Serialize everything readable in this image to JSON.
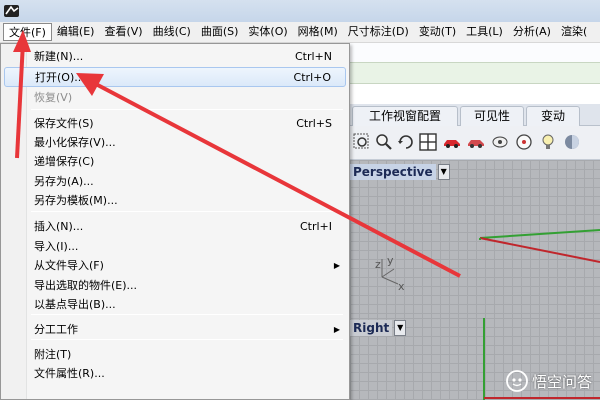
{
  "menubar": {
    "items": [
      {
        "label": "文件(F)",
        "active": true
      },
      {
        "label": "编辑(E)"
      },
      {
        "label": "查看(V)"
      },
      {
        "label": "曲线(C)"
      },
      {
        "label": "曲面(S)"
      },
      {
        "label": "实体(O)"
      },
      {
        "label": "网格(M)"
      },
      {
        "label": "尺寸标注(D)"
      },
      {
        "label": "变动(T)"
      },
      {
        "label": "工具(L)"
      },
      {
        "label": "分析(A)"
      },
      {
        "label": "渲染("
      }
    ]
  },
  "file_menu": {
    "items": [
      {
        "label": "新建(N)...",
        "shortcut": "Ctrl+N"
      },
      {
        "label": "打开(O)...",
        "shortcut": "Ctrl+O",
        "highlighted": true
      },
      {
        "label": "恢复(V)",
        "disabled": true
      },
      {
        "label": "保存文件(S)",
        "shortcut": "Ctrl+S"
      },
      {
        "label": "最小化保存(V)..."
      },
      {
        "label": "递增保存(C)"
      },
      {
        "label": "另存为(A)..."
      },
      {
        "label": "另存为模板(M)..."
      },
      {
        "label": "插入(N)...",
        "shortcut": "Ctrl+I"
      },
      {
        "label": "导入(I)..."
      },
      {
        "label": "从文件导入(F)",
        "submenu": true
      },
      {
        "label": "导出选取的物件(E)..."
      },
      {
        "label": "以基点导出(B)..."
      },
      {
        "label": "分工工作",
        "submenu": true
      },
      {
        "label": "附注(T)"
      },
      {
        "label": "文件属性(R)..."
      }
    ]
  },
  "toolbar_tabs": [
    "工作视窗配置",
    "可见性",
    "变动"
  ],
  "toolbar_icons": [
    "zoom-window-icon",
    "zoom-icon",
    "rotate-view-icon",
    "four-viewports-icon",
    "car-icon",
    "car-mirror-icon",
    "camera-icon",
    "target-icon",
    "light-bulb-icon",
    "shade-icon"
  ],
  "viewports": {
    "perspective": {
      "title": "Perspective",
      "axis_y": "y",
      "axis_z": "z",
      "axis_x": "x"
    },
    "right": {
      "title": "Right"
    }
  },
  "watermark": {
    "text": "悟空问答"
  },
  "colors": {
    "annotation_arrow": "#e8363a",
    "axis_red": "#c0262c",
    "axis_green": "#33a033",
    "menu_highlight_border": "#a9c7ef"
  }
}
